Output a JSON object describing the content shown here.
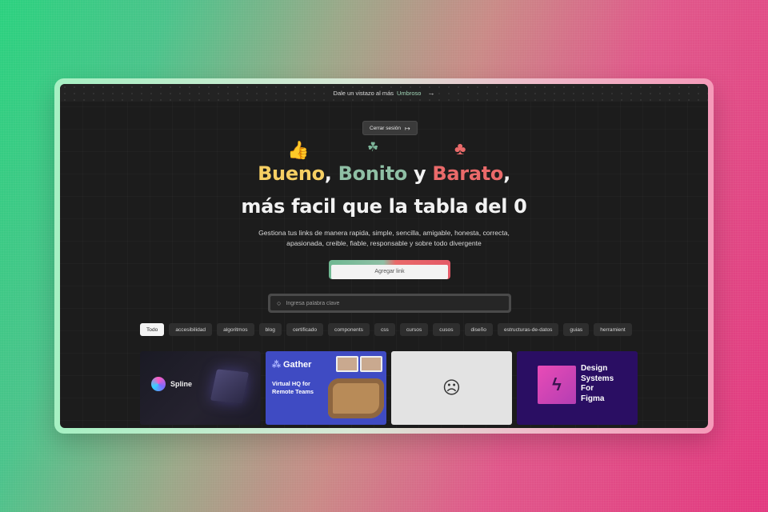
{
  "banner": {
    "prefix": "Dale un vistazo al más",
    "brand": "Umbroso",
    "arrow": "→"
  },
  "header": {
    "logout_label": "Cerrar sesión",
    "logout_icon": "↦"
  },
  "hero": {
    "emojis": {
      "thumb": "👍",
      "star": "☘",
      "club": "♣"
    },
    "word1": "Bueno",
    "sep1": ", ",
    "word2": "Bonito",
    "sep2": " y ",
    "word3": "Barato",
    "sep3": ",",
    "line2": "más facil que la tabla del 0",
    "subtitle": "Gestiona tus links de manera rapida, simple, sencilla, amigable, honesta, correcta, apasionada, creible, fiable, responsable y sobre todo divergente",
    "add_label": "Agregar link",
    "colors": {
      "yellow": "#f6cf63",
      "green": "#8fbfa5",
      "red": "#ea6a6a"
    }
  },
  "search": {
    "placeholder": "Ingresa palabra clave",
    "icon": "○"
  },
  "tags": [
    "Todo",
    "accesibilidad",
    "algoritmos",
    "blog",
    "certificado",
    "components",
    "css",
    "cursos",
    "cusos",
    "diseño",
    "estructuras-de-datos",
    "guias",
    "herramient"
  ],
  "cards": {
    "spline": {
      "name": "Spline"
    },
    "gather": {
      "name": "Gather",
      "icon": "⁂",
      "line1": "Virtual HQ for",
      "line2": "Remote Teams"
    },
    "error": {
      "face": "☹"
    },
    "design": {
      "icon": "ϟ",
      "line1": "Design",
      "line2": "Systems",
      "line3": "For",
      "line4": "Figma"
    }
  }
}
